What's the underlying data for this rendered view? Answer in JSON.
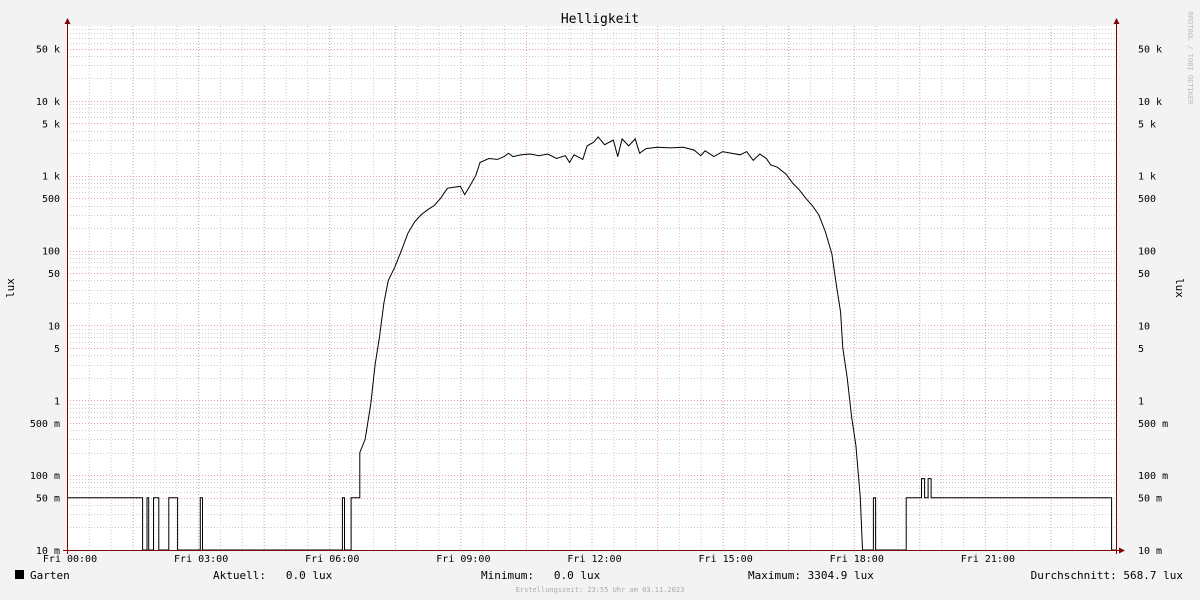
{
  "chart_data": {
    "type": "line",
    "title": "Helligkeit",
    "ylabel": "lux",
    "ylabel_right": "lux",
    "watermark": "RRDTOOL / TOBI OETIKER",
    "y_scale": "log",
    "ylim": [
      0.01,
      100000
    ],
    "xlim_hours": [
      0,
      24
    ],
    "x_ticks": [
      {
        "h": 0,
        "label": "Fri 00:00"
      },
      {
        "h": 3,
        "label": "Fri 03:00"
      },
      {
        "h": 6,
        "label": "Fri 06:00"
      },
      {
        "h": 9,
        "label": "Fri 09:00"
      },
      {
        "h": 12,
        "label": "Fri 12:00"
      },
      {
        "h": 15,
        "label": "Fri 15:00"
      },
      {
        "h": 18,
        "label": "Fri 18:00"
      },
      {
        "h": 21,
        "label": "Fri 21:00"
      }
    ],
    "y_ticks": [
      {
        "v": 0.01,
        "label": "10 m"
      },
      {
        "v": 0.05,
        "label": "50 m"
      },
      {
        "v": 0.1,
        "label": "100 m"
      },
      {
        "v": 0.5,
        "label": "500 m"
      },
      {
        "v": 1,
        "label": "1"
      },
      {
        "v": 5,
        "label": "5"
      },
      {
        "v": 10,
        "label": "10"
      },
      {
        "v": 50,
        "label": "50"
      },
      {
        "v": 100,
        "label": "100"
      },
      {
        "v": 500,
        "label": "500"
      },
      {
        "v": 1000,
        "label": "1 k"
      },
      {
        "v": 5000,
        "label": "5 k"
      },
      {
        "v": 10000,
        "label": "10 k"
      },
      {
        "v": 50000,
        "label": "50 k"
      }
    ],
    "series": [
      {
        "name": "Garten",
        "color": "#000000",
        "points": [
          [
            0.0,
            0.05
          ],
          [
            1.73,
            0.05
          ],
          [
            1.73,
            0.01
          ],
          [
            1.83,
            0.01
          ],
          [
            1.83,
            0.05
          ],
          [
            1.87,
            0.05
          ],
          [
            1.87,
            0.01
          ],
          [
            1.98,
            0.01
          ],
          [
            1.98,
            0.05
          ],
          [
            2.1,
            0.05
          ],
          [
            2.1,
            0.01
          ],
          [
            2.33,
            0.01
          ],
          [
            2.33,
            0.05
          ],
          [
            2.53,
            0.05
          ],
          [
            2.53,
            0.01
          ],
          [
            3.05,
            0.01
          ],
          [
            3.05,
            0.05
          ],
          [
            3.1,
            0.05
          ],
          [
            3.1,
            0.01
          ],
          [
            6.3,
            0.01
          ],
          [
            6.3,
            0.05
          ],
          [
            6.35,
            0.05
          ],
          [
            6.35,
            0.01
          ],
          [
            6.5,
            0.01
          ],
          [
            6.5,
            0.05
          ],
          [
            6.7,
            0.05
          ],
          [
            6.7,
            0.2
          ],
          [
            6.82,
            0.3
          ],
          [
            6.95,
            0.9
          ],
          [
            7.05,
            3
          ],
          [
            7.15,
            7
          ],
          [
            7.25,
            20
          ],
          [
            7.35,
            40
          ],
          [
            7.5,
            60
          ],
          [
            7.65,
            100
          ],
          [
            7.8,
            170
          ],
          [
            7.95,
            240
          ],
          [
            8.1,
            300
          ],
          [
            8.25,
            350
          ],
          [
            8.4,
            400
          ],
          [
            8.55,
            500
          ],
          [
            8.7,
            680
          ],
          [
            8.85,
            700
          ],
          [
            9.0,
            720
          ],
          [
            9.1,
            560
          ],
          [
            9.2,
            700
          ],
          [
            9.35,
            1000
          ],
          [
            9.45,
            1500
          ],
          [
            9.65,
            1700
          ],
          [
            9.85,
            1650
          ],
          [
            10.0,
            1800
          ],
          [
            10.1,
            2000
          ],
          [
            10.2,
            1800
          ],
          [
            10.4,
            1900
          ],
          [
            10.6,
            1950
          ],
          [
            10.8,
            1850
          ],
          [
            11.0,
            1950
          ],
          [
            11.2,
            1700
          ],
          [
            11.4,
            1850
          ],
          [
            11.5,
            1500
          ],
          [
            11.6,
            1900
          ],
          [
            11.8,
            1650
          ],
          [
            11.9,
            2500
          ],
          [
            12.05,
            2800
          ],
          [
            12.15,
            3300
          ],
          [
            12.3,
            2600
          ],
          [
            12.5,
            3000
          ],
          [
            12.6,
            1800
          ],
          [
            12.7,
            3100
          ],
          [
            12.85,
            2500
          ],
          [
            13.0,
            3100
          ],
          [
            13.1,
            2000
          ],
          [
            13.25,
            2300
          ],
          [
            13.5,
            2400
          ],
          [
            13.8,
            2350
          ],
          [
            14.1,
            2400
          ],
          [
            14.35,
            2200
          ],
          [
            14.5,
            1850
          ],
          [
            14.6,
            2150
          ],
          [
            14.8,
            1800
          ],
          [
            15.0,
            2100
          ],
          [
            15.2,
            2000
          ],
          [
            15.4,
            1900
          ],
          [
            15.55,
            2100
          ],
          [
            15.7,
            1600
          ],
          [
            15.85,
            1950
          ],
          [
            16.0,
            1700
          ],
          [
            16.1,
            1400
          ],
          [
            16.25,
            1300
          ],
          [
            16.45,
            1050
          ],
          [
            16.6,
            800
          ],
          [
            16.75,
            650
          ],
          [
            16.9,
            500
          ],
          [
            17.05,
            400
          ],
          [
            17.2,
            300
          ],
          [
            17.35,
            180
          ],
          [
            17.5,
            90
          ],
          [
            17.6,
            35
          ],
          [
            17.7,
            15
          ],
          [
            17.75,
            5
          ],
          [
            17.85,
            2
          ],
          [
            17.95,
            0.6
          ],
          [
            18.05,
            0.25
          ],
          [
            18.15,
            0.05
          ],
          [
            18.2,
            0.01
          ],
          [
            18.45,
            0.01
          ],
          [
            18.45,
            0.05
          ],
          [
            18.5,
            0.05
          ],
          [
            18.5,
            0.01
          ],
          [
            19.2,
            0.01
          ],
          [
            19.2,
            0.05
          ],
          [
            19.55,
            0.05
          ],
          [
            19.55,
            0.09
          ],
          [
            19.62,
            0.09
          ],
          [
            19.62,
            0.05
          ],
          [
            19.7,
            0.05
          ],
          [
            19.7,
            0.09
          ],
          [
            19.77,
            0.09
          ],
          [
            19.77,
            0.05
          ],
          [
            23.9,
            0.05
          ],
          [
            23.9,
            0.01
          ],
          [
            24.0,
            0.01
          ]
        ]
      }
    ],
    "legend": {
      "series_label": "Garten",
      "aktuell": "Aktuell:   0.0 lux",
      "minimum": "Minimum:   0.0 lux",
      "maximum": "Maximum: 3304.9 lux",
      "durchschnitt": "Durchschnitt: 568.7 lux"
    },
    "footer": "Erstellungszeit: 23:55 Uhr am 03.11.2023",
    "colors": {
      "background": "#f3f3f3",
      "canvas": "#ffffff",
      "major_grid": "#e6a0a0",
      "minor_grid": "#cccccc",
      "axis": "#7f0000",
      "line": "#000000"
    }
  }
}
